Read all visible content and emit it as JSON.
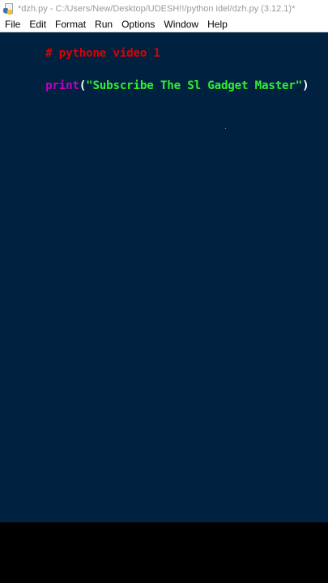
{
  "window": {
    "title": "*dzh.py - C:/Users/New/Desktop/UDESH!!/python idel/dzh.py (3.12.1)*"
  },
  "menu": {
    "items": [
      {
        "label": "File"
      },
      {
        "label": "Edit"
      },
      {
        "label": "Format"
      },
      {
        "label": "Run"
      },
      {
        "label": "Options"
      },
      {
        "label": "Window"
      },
      {
        "label": "Help"
      }
    ]
  },
  "editor": {
    "comment_line": "# pythone video 1",
    "code": {
      "function": "print",
      "open_paren": "(",
      "string": "\"Subscribe The Sl Gadget Master\"",
      "close_paren": ")"
    }
  },
  "colors": {
    "background": "#002240",
    "comment": "#dd0000",
    "builtin": "#c400c4",
    "string": "#33ee33",
    "paren": "#ffffff"
  }
}
